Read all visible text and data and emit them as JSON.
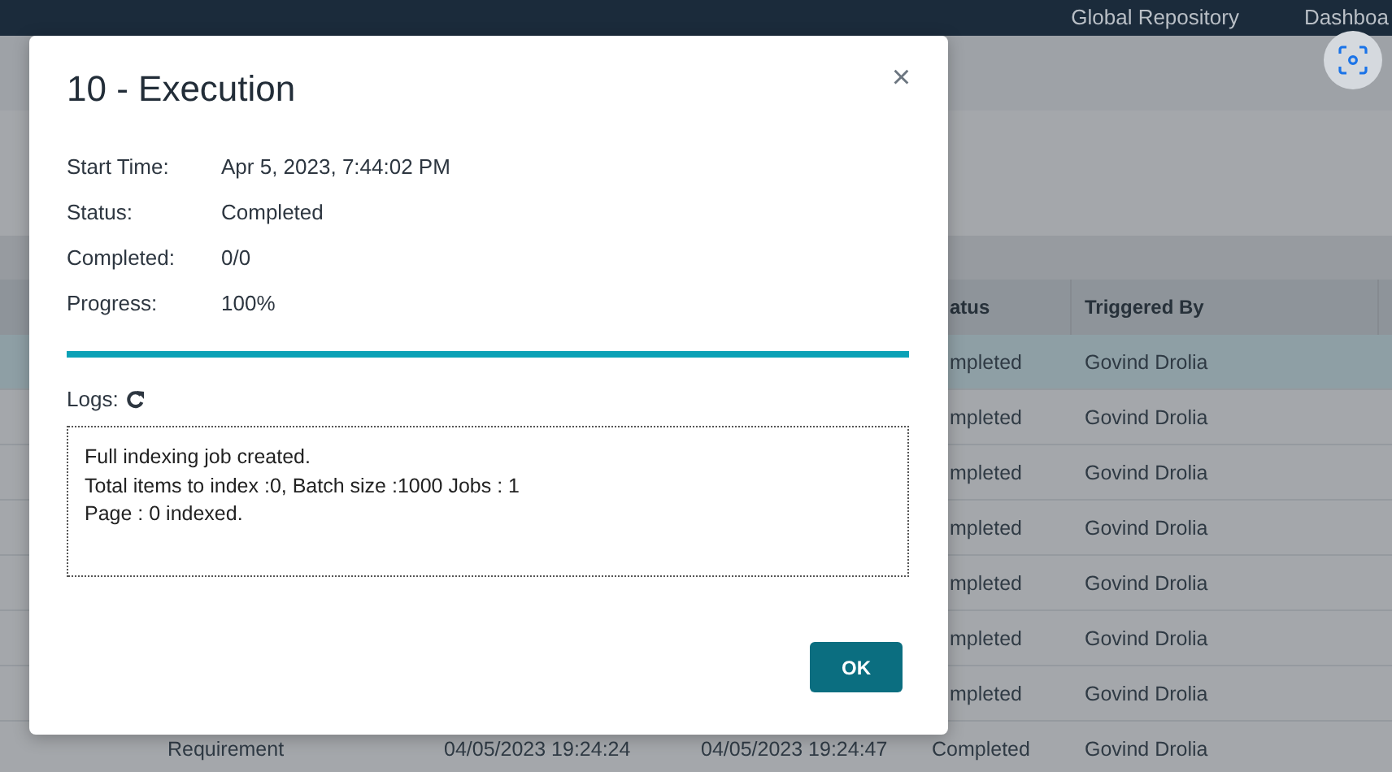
{
  "nav": {
    "links": [
      "Global Repository",
      "Dashboa"
    ]
  },
  "table": {
    "columns": [
      "atus",
      "Triggered By"
    ],
    "rows": [
      {
        "selected": true,
        "cells": [
          "mpleted",
          "Govind Drolia"
        ]
      },
      {
        "selected": false,
        "cells": [
          "mpleted",
          "Govind Drolia"
        ]
      },
      {
        "selected": false,
        "cells": [
          "mpleted",
          "Govind Drolia"
        ]
      },
      {
        "selected": false,
        "cells": [
          "mpleted",
          "Govind Drolia"
        ]
      },
      {
        "selected": false,
        "cells": [
          "mpleted",
          "Govind Drolia"
        ]
      },
      {
        "selected": false,
        "cells": [
          "mpleted",
          "Govind Drolia"
        ]
      },
      {
        "selected": false,
        "cells": [
          "mpleted",
          "Govind Drolia"
        ]
      },
      {
        "selected": false,
        "cells": [
          "Requirement",
          "04/05/2023 19:24:24",
          "04/05/2023 19:24:47",
          "Completed",
          "Govind Drolia"
        ]
      }
    ]
  },
  "dialog": {
    "title": "10 - Execution",
    "close": "×",
    "fields": [
      {
        "label": "Start Time:",
        "value": "Apr 5, 2023, 7:44:02 PM"
      },
      {
        "label": "Status:",
        "value": "Completed"
      },
      {
        "label": "Completed:",
        "value": "0/0"
      },
      {
        "label": "Progress:",
        "value": "100%"
      }
    ],
    "progress": {
      "level": 1.0
    },
    "logs_label": "Logs:",
    "log_lines": [
      "Full indexing job created.",
      "Total items to index :0, Batch size :1000 Jobs : 1",
      "Page : 0 indexed."
    ],
    "ok_button": "OK"
  }
}
